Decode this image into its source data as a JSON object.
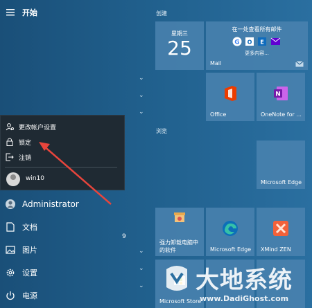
{
  "start": {
    "title": "开始"
  },
  "rail": {
    "account_name": "Administrator",
    "items": [
      {
        "label": "文档",
        "icon": "document-icon"
      },
      {
        "label": "图片",
        "icon": "pictures-icon"
      },
      {
        "label": "设置",
        "icon": "settings-icon"
      },
      {
        "label": "电源",
        "icon": "power-icon"
      }
    ],
    "stray_number": "9"
  },
  "account_menu": {
    "change_settings": "更改帐户设置",
    "lock": "锁定",
    "sign_out": "注销",
    "other_user": "win10"
  },
  "groups": {
    "create": "创建",
    "browse": "浏览"
  },
  "tiles": {
    "calendar": {
      "day": "星期三",
      "date": "25"
    },
    "mail": {
      "header": "在一处查看所有邮件",
      "more": "更多内容...",
      "label": "Mail"
    },
    "office": {
      "label": "Office"
    },
    "onenote": {
      "label": "OneNote for ..."
    },
    "edge_browse": {
      "label": "Microsoft Edge"
    },
    "uninstaller": {
      "label_line1": "强力卸载电脑中",
      "label_line2": "的软件"
    },
    "edge2": {
      "label": "Microsoft Edge"
    },
    "xmind": {
      "label": "XMind ZEN"
    },
    "store": {
      "label": "Microsoft Store"
    }
  },
  "watermark": {
    "brand": "大地系统",
    "url": "www.DadiGhost.com"
  },
  "colors": {
    "accent_red": "#e8453c",
    "tile_blue": "#4a82af",
    "flyout_bg": "#1f2a33"
  }
}
